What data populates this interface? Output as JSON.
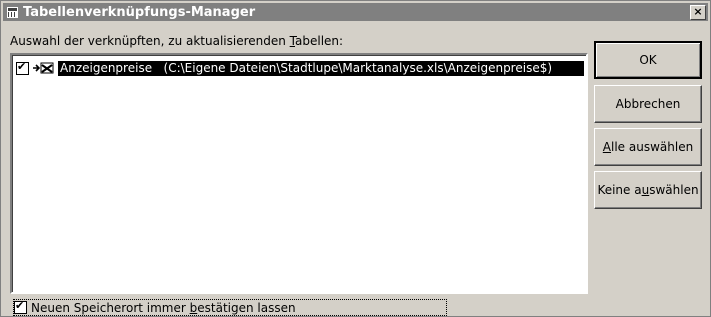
{
  "window": {
    "title": "Tabellenverknüpfungs-Manager",
    "close_label": "×"
  },
  "list": {
    "caption": "Auswahl der verknüpften, zu aktualisierenden Tabellen:",
    "items": [
      {
        "checked": true,
        "icon": "linked-excel-table-icon",
        "label": "Anzeigenpreise   (C:\\Eigene Dateien\\Stadtlupe\\Marktanalyse.xls\\Anzeigenpreise$)"
      }
    ]
  },
  "buttons": {
    "ok": "OK",
    "cancel": "Abbrechen",
    "select_all": "Alle auswählen",
    "select_none": "Keine auswählen"
  },
  "options": {
    "confirm_location_label": "Neuen Speicherort immer bestätigen lassen",
    "confirm_location_checked": true
  }
}
